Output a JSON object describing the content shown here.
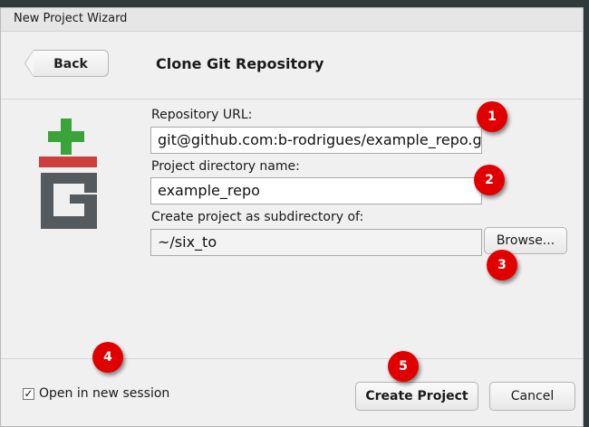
{
  "window": {
    "title": "New Project Wizard"
  },
  "header": {
    "back_label": "Back",
    "title": "Clone Git Repository"
  },
  "form": {
    "repo_url_label": "Repository URL:",
    "repo_url_value": "git@github.com:b-rodrigues/example_repo.git",
    "dir_name_label": "Project directory name:",
    "dir_name_value": "example_repo",
    "subdir_label": "Create project as subdirectory of:",
    "subdir_value": "~/six_to",
    "browse_label": "Browse..."
  },
  "footer": {
    "open_session_label": "Open in new session",
    "open_session_checked": true,
    "check_mark": "✓",
    "create_label": "Create Project",
    "cancel_label": "Cancel"
  },
  "annotations": [
    "1",
    "2",
    "3",
    "4",
    "5"
  ],
  "colors": {
    "badge": "#e00000",
    "git_green": "#3aa33a",
    "git_red": "#cf3e3e",
    "git_gray": "#555a5e"
  },
  "icons": {
    "logo": "git-logo-icon",
    "checkbox": "checkmark-icon",
    "back": "back-arrow-icon"
  }
}
